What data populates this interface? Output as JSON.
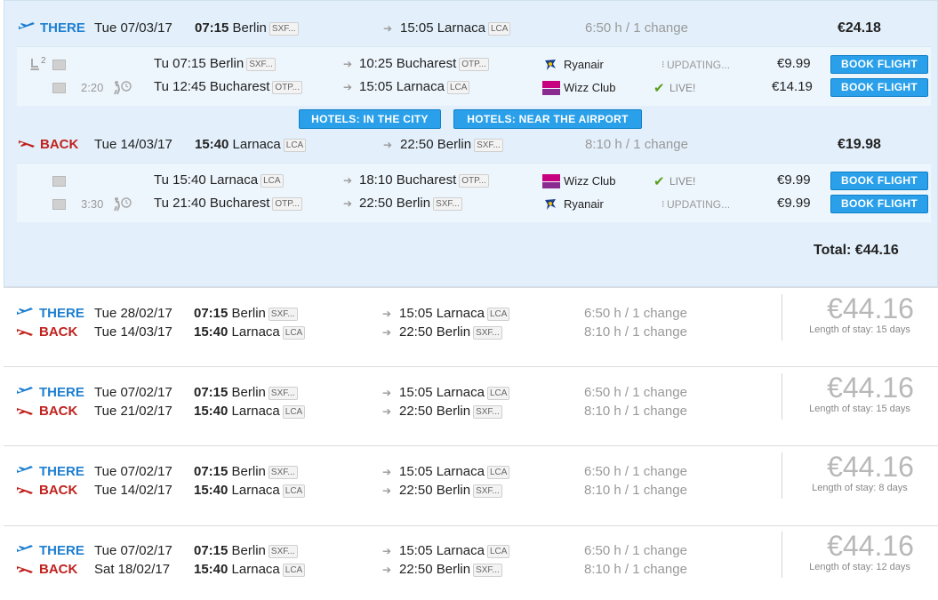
{
  "expanded": {
    "there": {
      "label": "THERE",
      "date": "Tue 07/03/17",
      "time": "07:15",
      "from": "Berlin",
      "from_code": "SXF...",
      "arr_time": "15:05",
      "to": "Larnaca",
      "to_code": "LCA",
      "duration": "6:50 h / 1 change",
      "price": "€24.18",
      "seats": "2",
      "layover": "2:20",
      "segments": [
        {
          "day": "Tu",
          "dep": "07:15",
          "from": "Berlin",
          "from_code": "SXF...",
          "arr": "10:25",
          "to": "Bucharest",
          "to_code": "OTP...",
          "airline": "Ryanair",
          "status": "UPDATING...",
          "price": "€9.99",
          "book": "BOOK FLIGHT"
        },
        {
          "day": "Tu",
          "dep": "12:45",
          "from": "Bucharest",
          "from_code": "OTP...",
          "arr": "15:05",
          "to": "Larnaca",
          "to_code": "LCA",
          "airline": "Wizz Club",
          "status": "LIVE!",
          "price": "€14.19",
          "book": "BOOK FLIGHT"
        }
      ]
    },
    "hotels": {
      "city": "HOTELS: IN THE CITY",
      "airport": "HOTELS: NEAR THE AIRPORT"
    },
    "back": {
      "label": "BACK",
      "date": "Tue 14/03/17",
      "time": "15:40",
      "from": "Larnaca",
      "from_code": "LCA",
      "arr_time": "22:50",
      "to": "Berlin",
      "to_code": "SXF...",
      "duration": "8:10 h / 1 change",
      "price": "€19.98",
      "layover": "3:30",
      "segments": [
        {
          "day": "Tu",
          "dep": "15:40",
          "from": "Larnaca",
          "from_code": "LCA",
          "arr": "18:10",
          "to": "Bucharest",
          "to_code": "OTP...",
          "airline": "Wizz Club",
          "status": "LIVE!",
          "price": "€9.99",
          "book": "BOOK FLIGHT"
        },
        {
          "day": "Tu",
          "dep": "21:40",
          "from": "Bucharest",
          "from_code": "OTP...",
          "arr": "22:50",
          "to": "Berlin",
          "to_code": "SXF...",
          "airline": "Ryanair",
          "status": "UPDATING...",
          "price": "€9.99",
          "book": "BOOK FLIGHT"
        }
      ]
    },
    "total": "Total: €44.16"
  },
  "results": [
    {
      "there_label": "THERE",
      "there_date": "Tue 28/02/17",
      "there_time": "07:15",
      "there_from": "Berlin",
      "there_from_code": "SXF...",
      "there_arr": "15:05",
      "there_to": "Larnaca",
      "there_to_code": "LCA",
      "there_dur": "6:50 h / 1 change",
      "back_label": "BACK",
      "back_date": "Tue 14/03/17",
      "back_time": "15:40",
      "back_from": "Larnaca",
      "back_from_code": "LCA",
      "back_arr": "22:50",
      "back_to": "Berlin",
      "back_to_code": "SXF...",
      "back_dur": "8:10 h / 1 change",
      "price": "€44.16",
      "stay": "Length of stay: 15 days"
    },
    {
      "there_label": "THERE",
      "there_date": "Tue 07/02/17",
      "there_time": "07:15",
      "there_from": "Berlin",
      "there_from_code": "SXF...",
      "there_arr": "15:05",
      "there_to": "Larnaca",
      "there_to_code": "LCA",
      "there_dur": "6:50 h / 1 change",
      "back_label": "BACK",
      "back_date": "Tue 21/02/17",
      "back_time": "15:40",
      "back_from": "Larnaca",
      "back_from_code": "LCA",
      "back_arr": "22:50",
      "back_to": "Berlin",
      "back_to_code": "SXF...",
      "back_dur": "8:10 h / 1 change",
      "price": "€44.16",
      "stay": "Length of stay: 15 days"
    },
    {
      "there_label": "THERE",
      "there_date": "Tue 07/02/17",
      "there_time": "07:15",
      "there_from": "Berlin",
      "there_from_code": "SXF...",
      "there_arr": "15:05",
      "there_to": "Larnaca",
      "there_to_code": "LCA",
      "there_dur": "6:50 h / 1 change",
      "back_label": "BACK",
      "back_date": "Tue 14/02/17",
      "back_time": "15:40",
      "back_from": "Larnaca",
      "back_from_code": "LCA",
      "back_arr": "22:50",
      "back_to": "Berlin",
      "back_to_code": "SXF...",
      "back_dur": "8:10 h / 1 change",
      "price": "€44.16",
      "stay": "Length of stay: 8 days"
    },
    {
      "there_label": "THERE",
      "there_date": "Tue 07/02/17",
      "there_time": "07:15",
      "there_from": "Berlin",
      "there_from_code": "SXF...",
      "there_arr": "15:05",
      "there_to": "Larnaca",
      "there_to_code": "LCA",
      "there_dur": "6:50 h / 1 change",
      "back_label": "BACK",
      "back_date": "Sat 18/02/17",
      "back_time": "15:40",
      "back_from": "Larnaca",
      "back_from_code": "LCA",
      "back_arr": "22:50",
      "back_to": "Berlin",
      "back_to_code": "SXF...",
      "back_dur": "8:10 h / 1 change",
      "price": "€44.16",
      "stay": "Length of stay: 12 days"
    }
  ],
  "colors": {
    "there": "#1e7fd0",
    "back": "#c0221e",
    "button": "#2aa0ea",
    "live": "#5a9e1e",
    "expanded_bg": "#e3f0fb"
  },
  "icons": {
    "there": "plane-takeoff-icon",
    "back": "plane-landing-icon",
    "seat": "seat-icon",
    "layover": "walking-clock-icon",
    "live": "checkmark-icon",
    "updating": "loading-icon",
    "arrow": "arrow-right-icon"
  }
}
